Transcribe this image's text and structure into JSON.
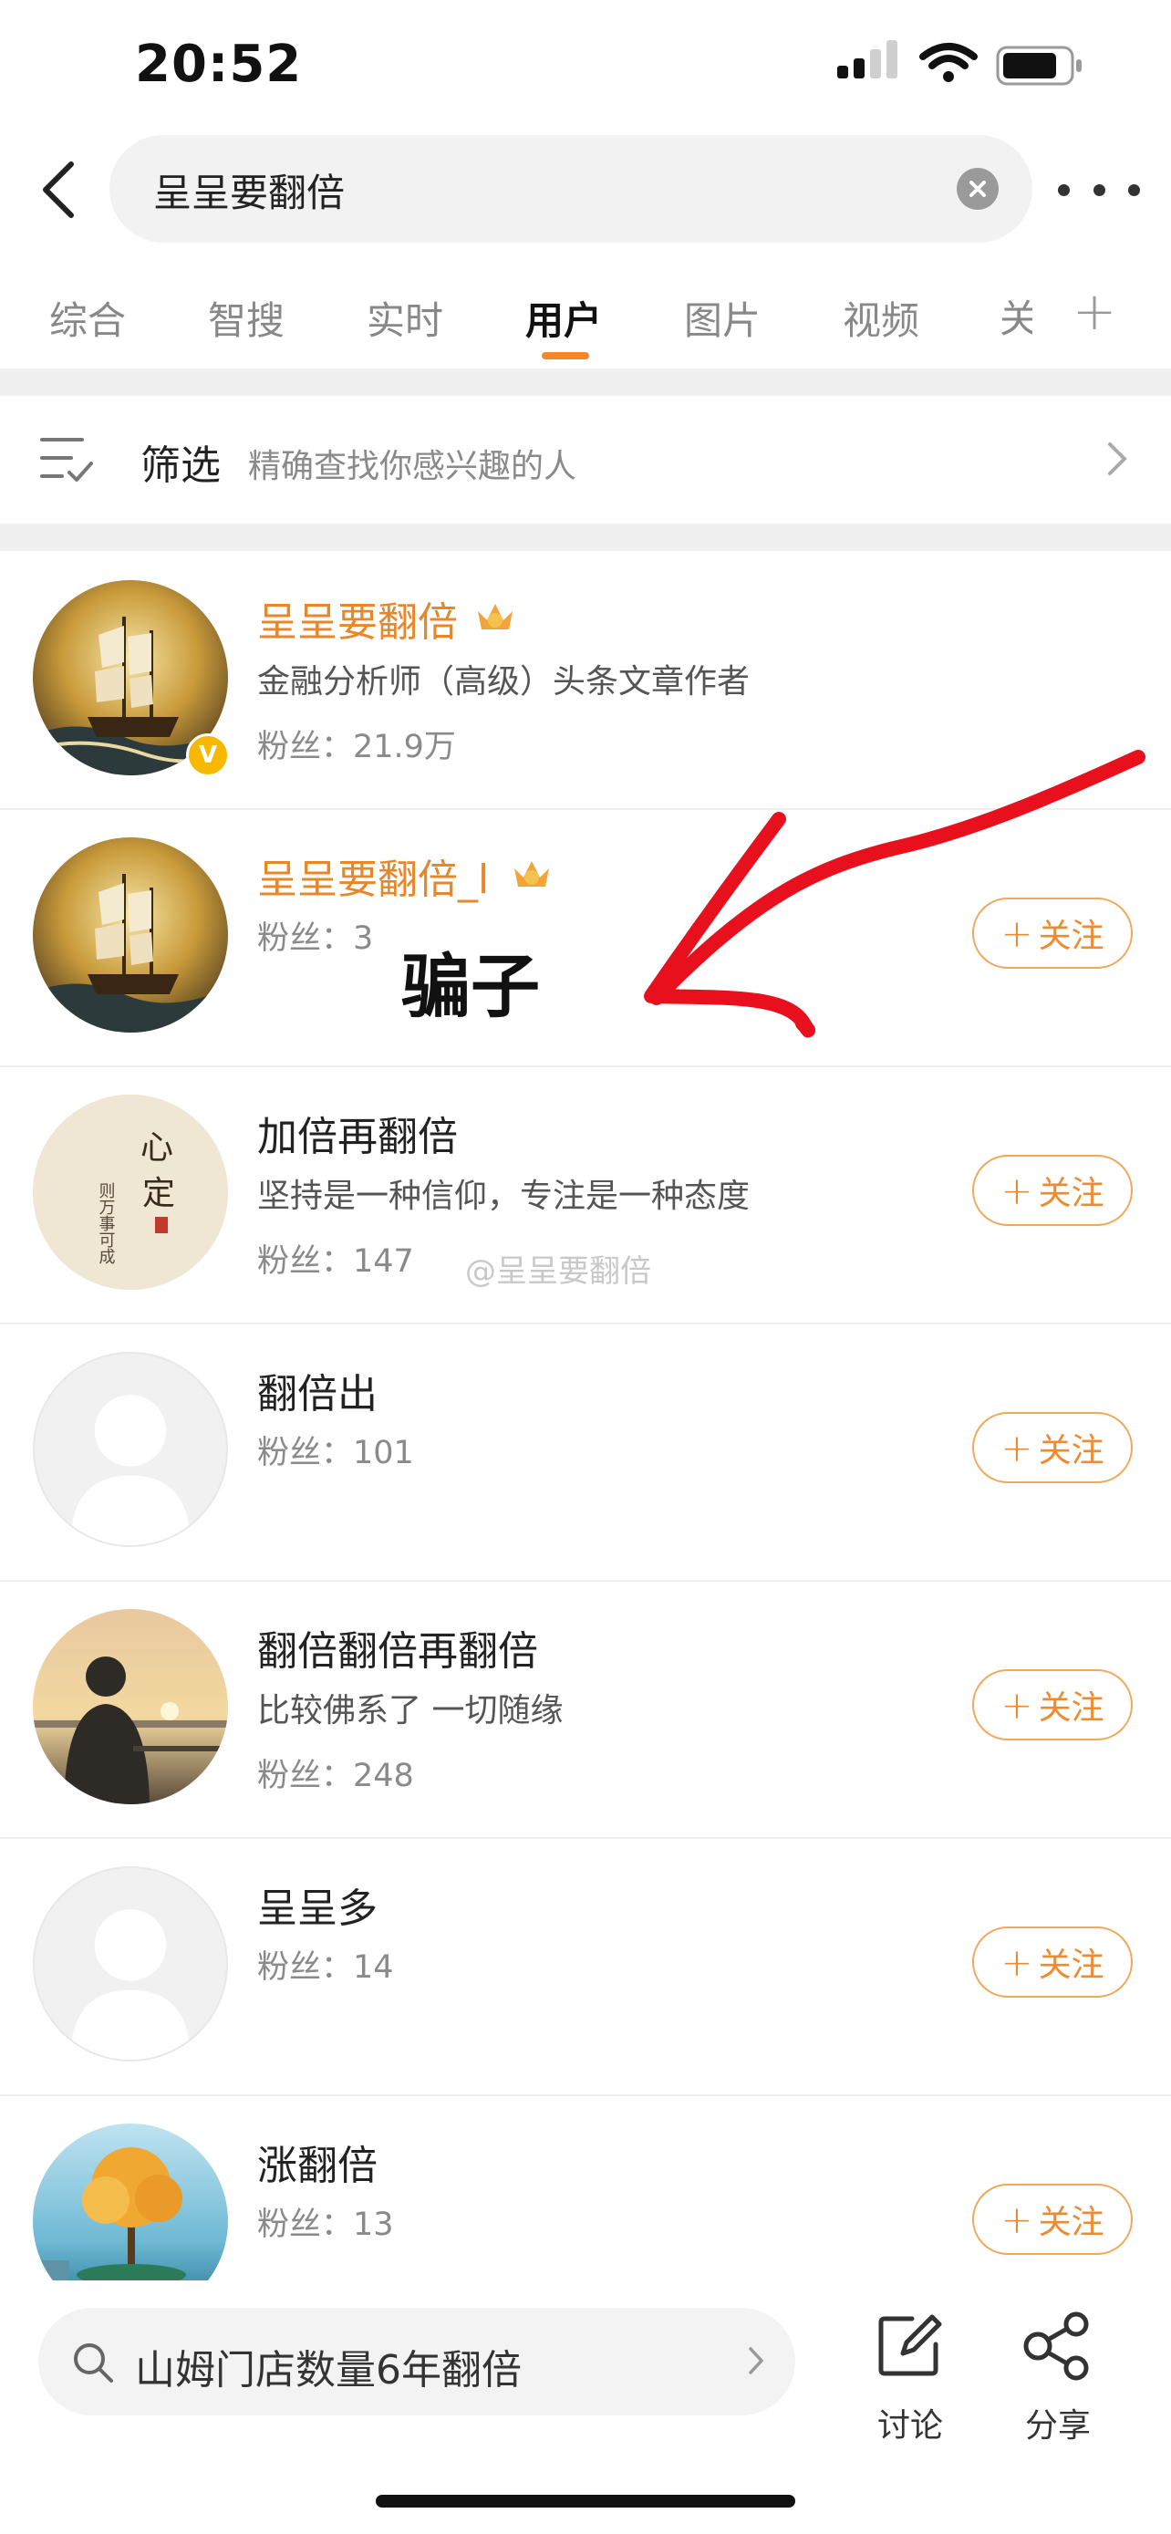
{
  "status_bar": {
    "time": "20:52"
  },
  "search": {
    "query": "呈呈要翻倍"
  },
  "tabs": [
    {
      "label": "综合"
    },
    {
      "label": "智搜"
    },
    {
      "label": "实时"
    },
    {
      "label": "用户"
    },
    {
      "label": "图片"
    },
    {
      "label": "视频"
    },
    {
      "label": "关"
    }
  ],
  "active_tab": "用户",
  "filter": {
    "label": "筛选",
    "hint": "精确查找你感兴趣的人"
  },
  "users": [
    {
      "name": "呈呈要翻倍",
      "desc": "金融分析师（高级）头条文章作者",
      "fans": "粉丝：21.9万",
      "follow_label": ""
    },
    {
      "name": "呈呈要翻倍_l",
      "desc": "",
      "fans": "粉丝：3",
      "follow_label": "关注"
    },
    {
      "name": "加倍再翻倍",
      "desc": "坚持是一种信仰，专注是一种态度",
      "fans": "粉丝：147",
      "follow_label": "关注"
    },
    {
      "name": "翻倍出",
      "desc": "",
      "fans": "粉丝：101",
      "follow_label": "关注"
    },
    {
      "name": "翻倍翻倍再翻倍",
      "desc": "比较佛系了 一切随缘",
      "fans": "粉丝：248",
      "follow_label": "关注"
    },
    {
      "name": "呈呈多",
      "desc": "",
      "fans": "粉丝：14",
      "follow_label": "关注"
    },
    {
      "name": "涨翻倍",
      "desc": "",
      "fans": "粉丝：13",
      "follow_label": "关注"
    }
  ],
  "avatar_text": [
    "心",
    "定",
    "则万事可成"
  ],
  "annotation": {
    "text": "骗子"
  },
  "watermark": "@呈呈要翻倍",
  "bottom_bar": {
    "search_text": "山姆门店数量6年翻倍",
    "discuss_label": "讨论",
    "share_label": "分享"
  },
  "colors": {
    "accent": "#f5862a",
    "vip_name": "#e8862a",
    "annotation_arrow": "#e8101c"
  }
}
